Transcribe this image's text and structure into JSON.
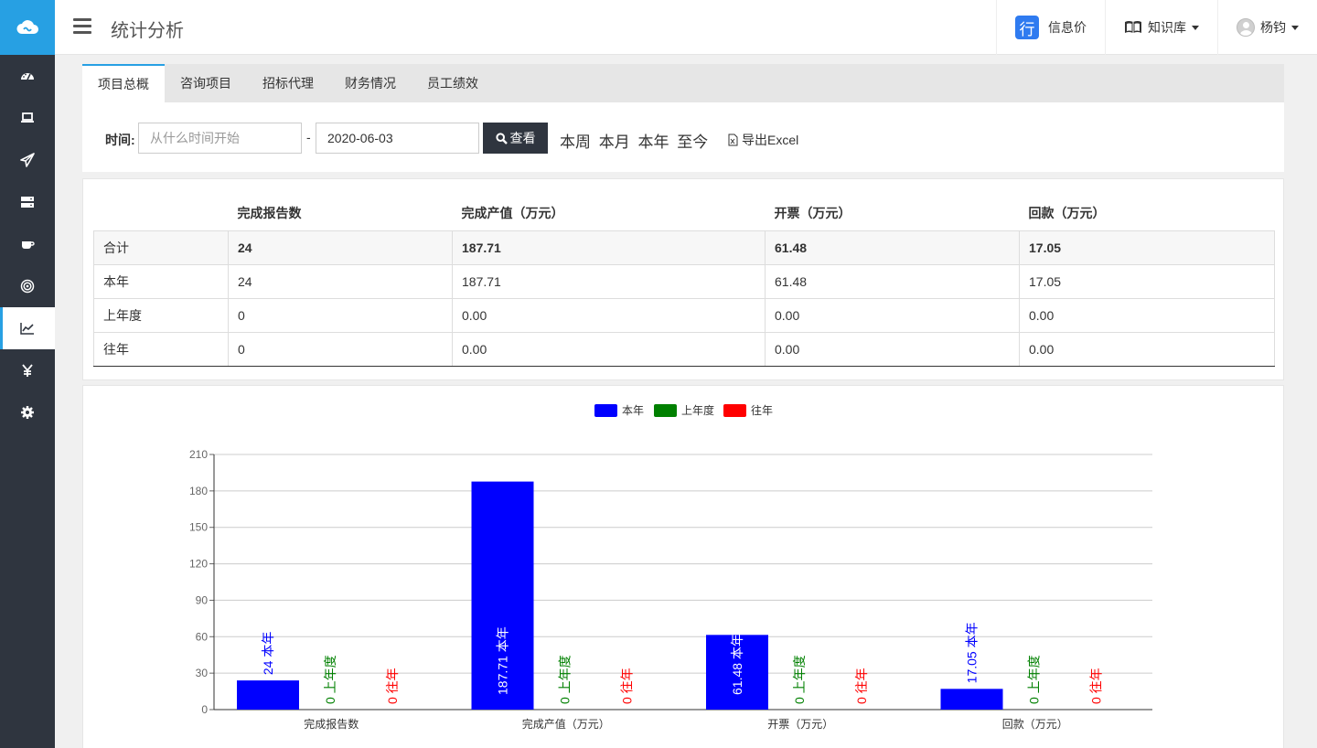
{
  "header": {
    "title": "统计分析",
    "items": [
      {
        "icon": "hang-badge",
        "badge_char": "行",
        "label": "信息价"
      },
      {
        "icon": "book-icon",
        "label": "知识库"
      },
      {
        "icon": "avatar",
        "label": "杨钧"
      }
    ]
  },
  "sidebar": {
    "items": [
      {
        "icon": "dashboard-icon"
      },
      {
        "icon": "laptop-icon"
      },
      {
        "icon": "paper-plane-icon"
      },
      {
        "icon": "server-icon"
      },
      {
        "icon": "coffee-icon"
      },
      {
        "icon": "target-icon"
      },
      {
        "icon": "line-chart-icon",
        "active": true
      },
      {
        "icon": "yen-icon"
      },
      {
        "icon": "gear-icon"
      }
    ]
  },
  "tabs": [
    "项目总概",
    "咨询项目",
    "招标代理",
    "财务情况",
    "员工绩效"
  ],
  "filter": {
    "label": "时间:",
    "start_placeholder": "从什么时间开始",
    "end_value": "2020-06-03",
    "separator": "-",
    "search_label": "查看",
    "quick": [
      "本周",
      "本月",
      "本年",
      "至今"
    ],
    "export_label": "导出Excel"
  },
  "table": {
    "headers": [
      "",
      "完成报告数",
      "完成产值（万元）",
      "开票（万元）",
      "回款（万元）"
    ],
    "rows": [
      [
        "合计",
        "24",
        "187.71",
        "61.48",
        "17.05"
      ],
      [
        "本年",
        "24",
        "187.71",
        "61.48",
        "17.05"
      ],
      [
        "上年度",
        "0",
        "0.00",
        "0.00",
        "0.00"
      ],
      [
        "往年",
        "0",
        "0.00",
        "0.00",
        "0.00"
      ]
    ]
  },
  "chart_data": {
    "type": "bar",
    "categories": [
      "完成报告数",
      "完成产值（万元）",
      "开票（万元）",
      "回款（万元）"
    ],
    "series": [
      {
        "name": "本年",
        "color": "#0000ff",
        "values": [
          24,
          187.71,
          61.48,
          17.05
        ],
        "labels": [
          "24",
          "187.71",
          "61.48",
          "17.05"
        ]
      },
      {
        "name": "上年度",
        "color": "#008000",
        "values": [
          0,
          0,
          0,
          0
        ],
        "labels": [
          "0",
          "0",
          "0",
          "0"
        ]
      },
      {
        "name": "往年",
        "color": "#ff0000",
        "values": [
          0,
          0,
          0,
          0
        ],
        "labels": [
          "0",
          "0",
          "0",
          "0"
        ]
      }
    ],
    "ylim": [
      0,
      210
    ],
    "yticks": [
      0,
      30,
      60,
      90,
      120,
      150,
      180,
      210
    ],
    "grid": true,
    "legend_position": "top-center"
  }
}
